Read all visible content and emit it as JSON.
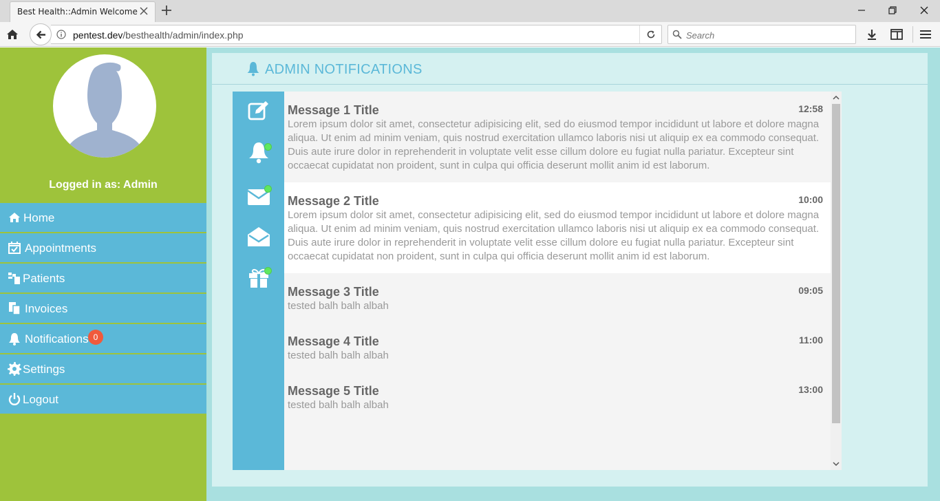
{
  "browser": {
    "tab_title": "Best Health::Admin Welcome",
    "url_host": "pentest.dev",
    "url_path": "/besthealth/admin/index.php",
    "search_placeholder": "Search"
  },
  "sidebar": {
    "logged_in_text": "Logged in as: Admin",
    "items": [
      {
        "label": "Home",
        "icon": "home-icon"
      },
      {
        "label": "Appointments",
        "icon": "calendar-check-icon"
      },
      {
        "label": "Patients",
        "icon": "patients-icon"
      },
      {
        "label": "Invoices",
        "icon": "invoices-icon"
      },
      {
        "label": "Notifications",
        "icon": "bell-icon",
        "badge": "0"
      },
      {
        "label": "Settings",
        "icon": "gear-icon"
      },
      {
        "label": "Logout",
        "icon": "power-icon"
      }
    ]
  },
  "header": {
    "title": "ADMIN NOTIFICATIONS",
    "icon": "bell-icon"
  },
  "notification_icons": [
    {
      "icon": "edit-icon",
      "dot": false
    },
    {
      "icon": "bell-icon",
      "dot": true
    },
    {
      "icon": "envelope-closed-icon",
      "dot": true
    },
    {
      "icon": "envelope-open-icon",
      "dot": false
    },
    {
      "icon": "gift-icon",
      "dot": true
    }
  ],
  "messages": [
    {
      "title": "Message 1 Title",
      "time": "12:58",
      "body": "Lorem ipsum dolor sit amet, consectetur adipisicing elit, sed do eiusmod tempor incididunt ut labore et dolore magna aliqua. Ut enim ad minim veniam, quis nostrud exercitation ullamco laboris nisi ut aliquip ex ea commodo consequat. Duis aute irure dolor in reprehenderit in voluptate velit esse cillum dolore eu fugiat nulla pariatur. Excepteur sint occaecat cupidatat non proident, sunt in culpa qui officia deserunt mollit anim id est laborum."
    },
    {
      "title": "Message 2 Title",
      "time": "10:00",
      "body": "Lorem ipsum dolor sit amet, consectetur adipisicing elit, sed do eiusmod tempor incididunt ut labore et dolore magna aliqua. Ut enim ad minim veniam, quis nostrud exercitation ullamco laboris nisi ut aliquip ex ea commodo consequat. Duis aute irure dolor in reprehenderit in voluptate velit esse cillum dolore eu fugiat nulla pariatur. Excepteur sint occaecat cupidatat non proident, sunt in culpa qui officia deserunt mollit anim id est laborum."
    },
    {
      "title": "Message 3 Title",
      "time": "09:05",
      "body": "tested balh balh albah"
    },
    {
      "title": "Message 4 Title",
      "time": "11:00",
      "body": "tested balh balh albah"
    },
    {
      "title": "Message 5 Title",
      "time": "13:00",
      "body": "tested balh balh albah"
    }
  ],
  "colors": {
    "sidebar_green": "#9ec33b",
    "menu_blue": "#5bb8d8",
    "badge_red": "#f05a3c",
    "status_dot": "#5fe85f"
  }
}
